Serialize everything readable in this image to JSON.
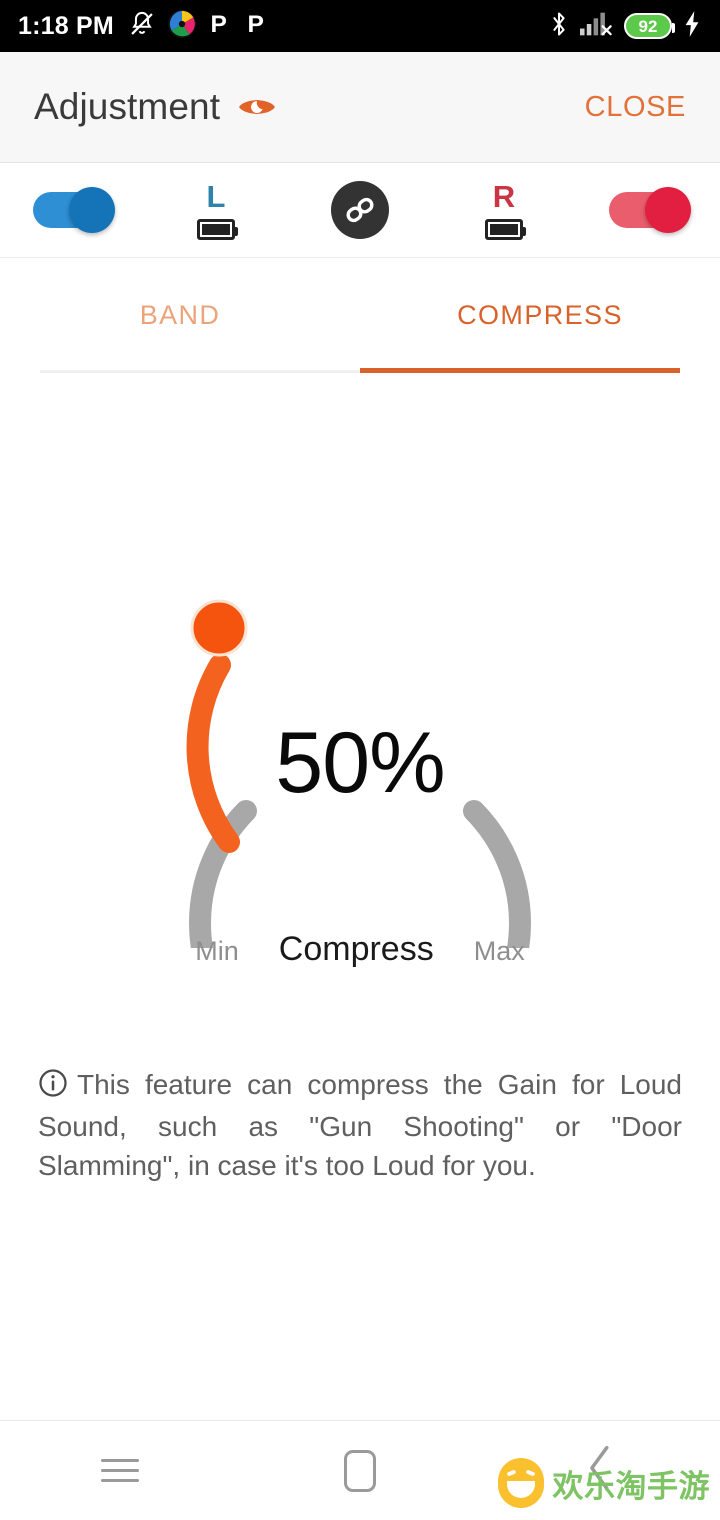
{
  "status_bar": {
    "time": "1:18 PM",
    "battery_percent": "92",
    "battery_color": "#5dc94a",
    "left_icons": [
      "mute-bell-icon",
      "pinwheel-app-icon",
      "p-app-icon",
      "p-app-icon-2"
    ],
    "right_icons": [
      "bluetooth-icon",
      "signal-no-sim-icon",
      "battery-icon",
      "charging-bolt-icon"
    ]
  },
  "app_bar": {
    "title": "Adjustment",
    "title_icon": "eye-icon",
    "title_icon_color": "#e2632a",
    "close_label": "CLOSE",
    "close_color": "#e2713a"
  },
  "device_row": {
    "left_toggle": {
      "name": "left-ear-toggle",
      "state": "on",
      "color": "#1573b8"
    },
    "left_channel": {
      "label": "L",
      "color": "#2f83ab",
      "battery_icon": "battery-full-icon"
    },
    "link_button": {
      "name": "link-channels-button",
      "icon": "chain-link-icon",
      "bg": "#333333"
    },
    "right_channel": {
      "label": "R",
      "color": "#c93545",
      "battery_icon": "battery-full-icon"
    },
    "right_toggle": {
      "name": "right-ear-toggle",
      "state": "on",
      "color": "#e21f40"
    }
  },
  "tabs": {
    "items": [
      {
        "label": "BAND",
        "active": false
      },
      {
        "label": "COMPRESS",
        "active": true
      }
    ],
    "active_color": "#d9622a",
    "inactive_color": "#eda37a"
  },
  "gauge": {
    "value_text": "50%",
    "value": 50,
    "min_label": "Min",
    "max_label": "Max",
    "title": "Compress",
    "track_color": "#a8a8a8",
    "progress_color": "#f4621f",
    "knob_color": "#f4540e"
  },
  "info": {
    "icon": "info-circle-icon",
    "text": "This feature can compress the Gain for Loud Sound, such as \"Gun Shooting\" or \"Door Slamming\", in case it's too Loud for you."
  },
  "nav_bar": {
    "menu_icon": "hamburger-menu-icon",
    "home_icon": "home-square-icon",
    "back_icon": "back-chevron-icon"
  },
  "watermark": {
    "text": "欢乐淘手游",
    "text_color": "#7ec364",
    "face_color": "#fbc02d"
  },
  "chart_data": {
    "type": "gauge",
    "title": "Compress",
    "value": 50,
    "value_label": "50%",
    "min": 0,
    "max": 100,
    "min_label": "Min",
    "max_label": "Max",
    "arc_start_deg": 215,
    "arc_sweep_deg": 250,
    "progress_color": "#f4621f",
    "track_color": "#a8a8a8"
  }
}
